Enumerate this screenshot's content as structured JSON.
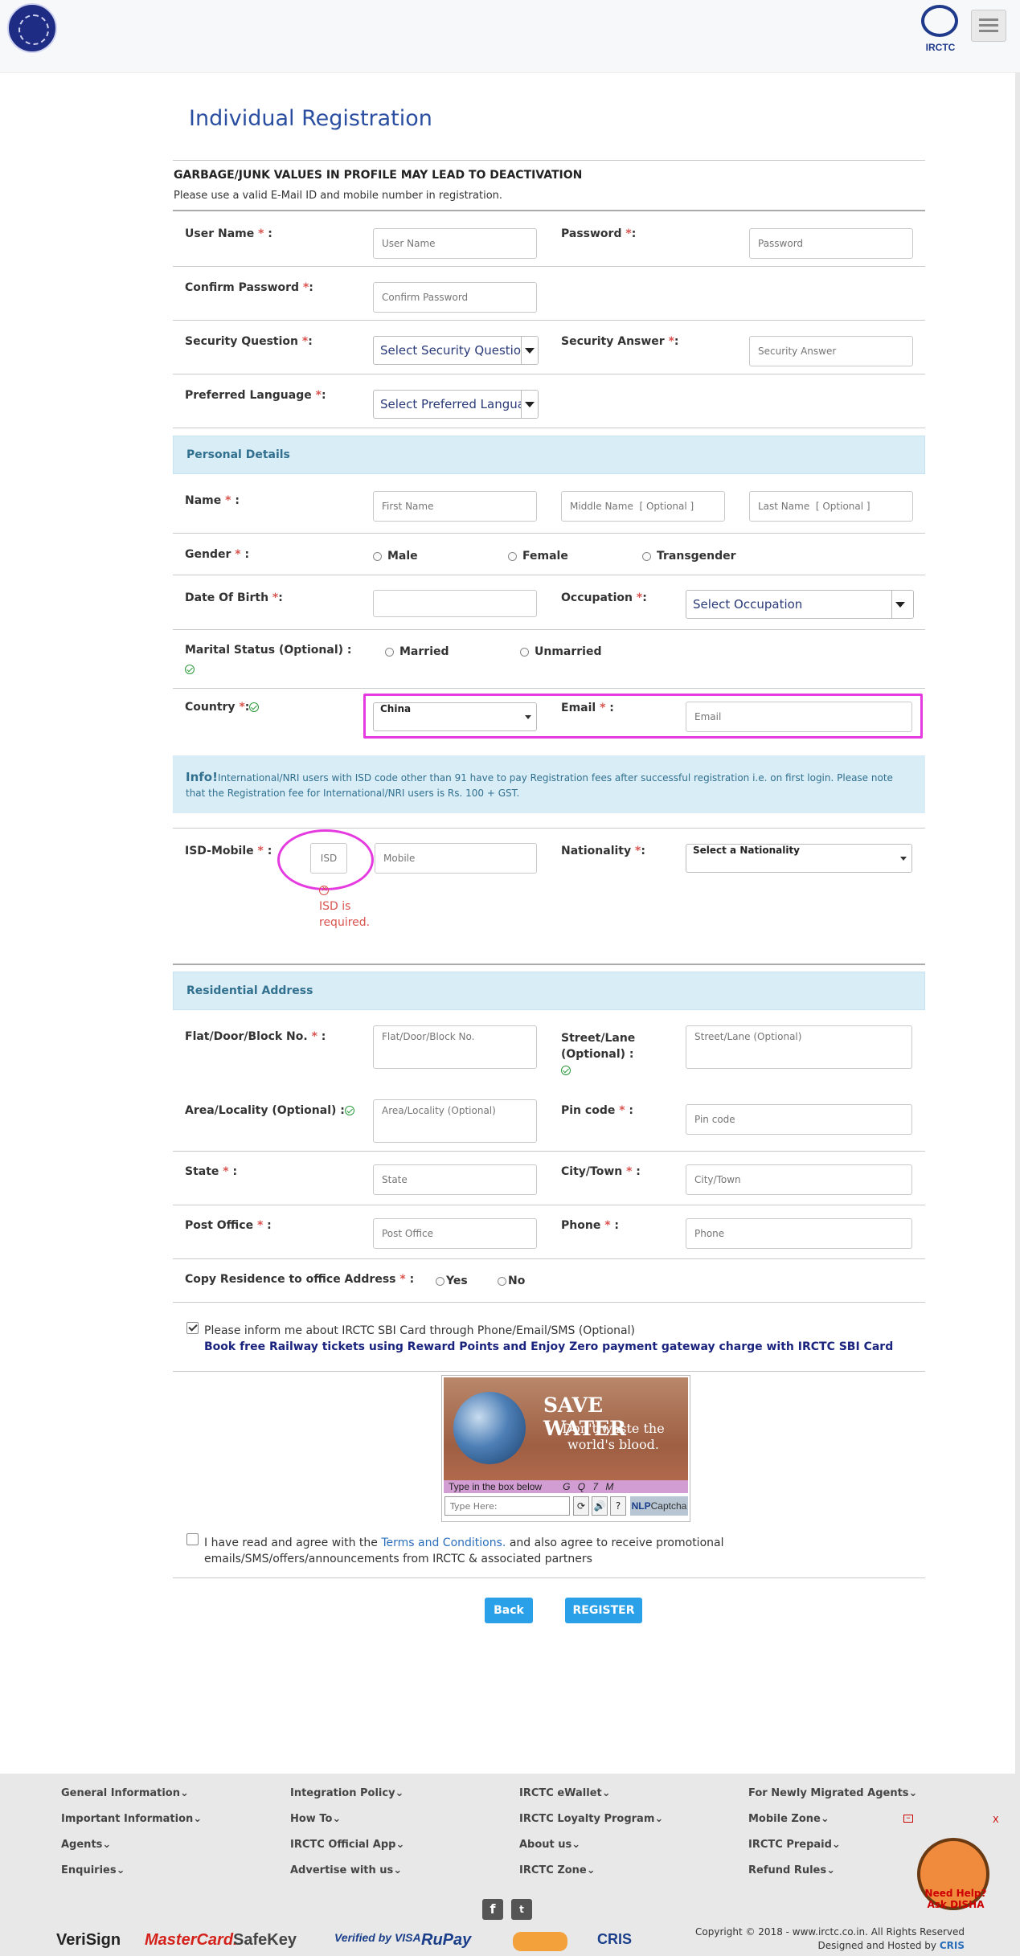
{
  "header": {
    "logo_text": "IRCTC"
  },
  "page": {
    "title": "Individual Registration",
    "warning": "GARBAGE/JUNK VALUES IN PROFILE MAY LEAD TO DEACTIVATION",
    "note": "Please use a valid E-Mail ID and mobile number in registration."
  },
  "form": {
    "username_label": "User Name",
    "username_placeholder": "User Name",
    "password_label": "Password",
    "password_placeholder": "Password",
    "confirm_label": "Confirm Password",
    "confirm_placeholder": "Confirm Password",
    "secq_label": "Security Question",
    "secq_value": "Select Security Question",
    "seca_label": "Security Answer",
    "seca_placeholder": "Security Answer",
    "lang_label": "Preferred Language",
    "lang_value": "Select Preferred Language",
    "personal_section": "Personal Details",
    "name_label": "Name",
    "first_placeholder": "First Name",
    "middle_placeholder": "Middle Name  [ Optional ]",
    "last_placeholder": "Last Name  [ Optional ]",
    "gender_label": "Gender",
    "gender_options": [
      "Male",
      "Female",
      "Transgender"
    ],
    "dob_label": "Date Of Birth",
    "occupation_label": "Occupation",
    "occupation_value": "Select Occupation",
    "marital_label": "Marital Status (Optional) :",
    "marital_options": [
      "Married",
      "Unmarried"
    ],
    "country_label": "Country",
    "country_value": "China",
    "email_label": "Email",
    "email_placeholder": "Email",
    "info_title": "Info!",
    "info_text": "International/NRI users with ISD code other than 91 have to pay Registration fees after successful registration i.e. on first login. Please note that the Registration fee for International/NRI users is Rs. 100 + GST.",
    "isd_label": "ISD-Mobile",
    "isd_placeholder": "ISD",
    "mobile_placeholder": "Mobile",
    "isd_error": "ISD is required.",
    "nationality_label": "Nationality",
    "nationality_value": "Select a Nationality",
    "residential_section": "Residential Address",
    "flat_label": "Flat/Door/Block No.",
    "flat_placeholder": "Flat/Door/Block No.",
    "street_label": "Street/Lane (Optional) :",
    "street_placeholder": "Street/Lane (Optional)",
    "area_label": "Area/Locality (Optional) :",
    "area_placeholder": "Area/Locality (Optional)",
    "pin_label": "Pin code",
    "pin_placeholder": "Pin code",
    "state_label": "State",
    "state_placeholder": "State",
    "city_label": "City/Town",
    "city_placeholder": "City/Town",
    "po_label": "Post Office",
    "po_placeholder": "Post Office",
    "phone_label": "Phone",
    "phone_placeholder": "Phone",
    "copy_label": "Copy Residence to office Address",
    "copy_options": [
      "Yes",
      "No"
    ],
    "sbi_text": "Please inform me about IRCTC SBI Card through Phone/Email/SMS (Optional)",
    "sbi_sub": "Book free Railway tickets using Reward Points and Enjoy Zero payment gateway charge with IRCTC SBI Card",
    "terms_pre": "I have read and agree with the",
    "terms_link": "Terms and Conditions.",
    "terms_post": "and also agree to receive promotional emails/SMS/offers/announcements from IRCTC & associated partners",
    "back_label": "Back",
    "register_label": "REGISTER"
  },
  "captcha": {
    "title": "SAVE WATER",
    "subtitle": "Don't waste the world's blood.",
    "prompt": "Type in the box below",
    "code": "G Q 7 M",
    "input_placeholder": "Type Here:",
    "brand": "NLP",
    "brand2": "Captcha"
  },
  "footer": {
    "col1": [
      "General Information",
      "Important Information",
      "Agents",
      "Enquiries"
    ],
    "col2": [
      "Integration Policy",
      "How To",
      "IRCTC Official App",
      "Advertise with us"
    ],
    "col3": [
      "IRCTC eWallet",
      "IRCTC Loyalty Program",
      "About us",
      "IRCTC Zone"
    ],
    "col4": [
      "For Newly Migrated Agents",
      "Mobile Zone",
      "IRCTC Prepaid",
      "Refund Rules"
    ],
    "copyright": "Copyright © 2018 - www.irctc.co.in. All Rights Reserved",
    "hosted": "Designed and Hosted by",
    "hosted_by": "CRIS",
    "brands": [
      "VeriSign",
      "MasterCard.",
      "SafeKey",
      "Verified by VISA",
      "RuPay",
      "CRIS"
    ],
    "disha": "Need Help? Ask DISHA"
  }
}
